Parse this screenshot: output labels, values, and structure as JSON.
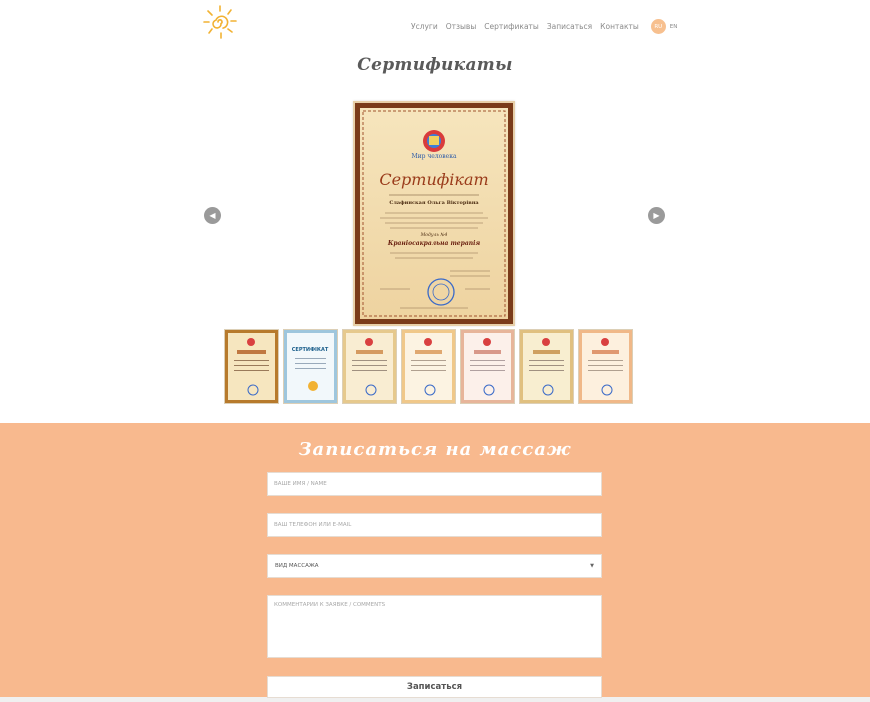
{
  "header": {
    "logo_icon": "sun-spiral-logo",
    "nav": [
      "Услуги",
      "Отзывы",
      "Сертификаты",
      "Записаться",
      "Контакты"
    ],
    "lang_active": "RU",
    "lang_other": "EN"
  },
  "certificates": {
    "title": "Сертификаты",
    "main_certificate": {
      "title": "Сертифікат",
      "logo_text": "Мир человека",
      "name": "Слафинская Ольга Вікторівна",
      "module": "Модуль №4",
      "course": "Краніосакральна терапія"
    },
    "prev_icon": "chevron-left-icon",
    "next_icon": "chevron-right-icon",
    "thumbnails": [
      {
        "style": "ornate"
      },
      {
        "style": "blue",
        "heading": "СЕРТИФІКАТ"
      },
      {
        "style": "ornate"
      },
      {
        "style": "ornate"
      },
      {
        "style": "ornate"
      },
      {
        "style": "ornate"
      },
      {
        "style": "ornate"
      }
    ]
  },
  "booking": {
    "title": "Записаться на массаж",
    "name_placeholder": "ВАШЕ ИМЯ / NAME",
    "contact_placeholder": "ВАШ ТЕЛЕФОН ИЛИ E-MAIL",
    "massage_type_value": "ВИД МАССАЖА",
    "comment_placeholder": "КОММЕНТАРИИ К ЗАЯВКЕ / COMMENTS",
    "submit_label": "Записаться"
  },
  "colors": {
    "accent": "#f8b98e",
    "logo": "#f2b233"
  }
}
